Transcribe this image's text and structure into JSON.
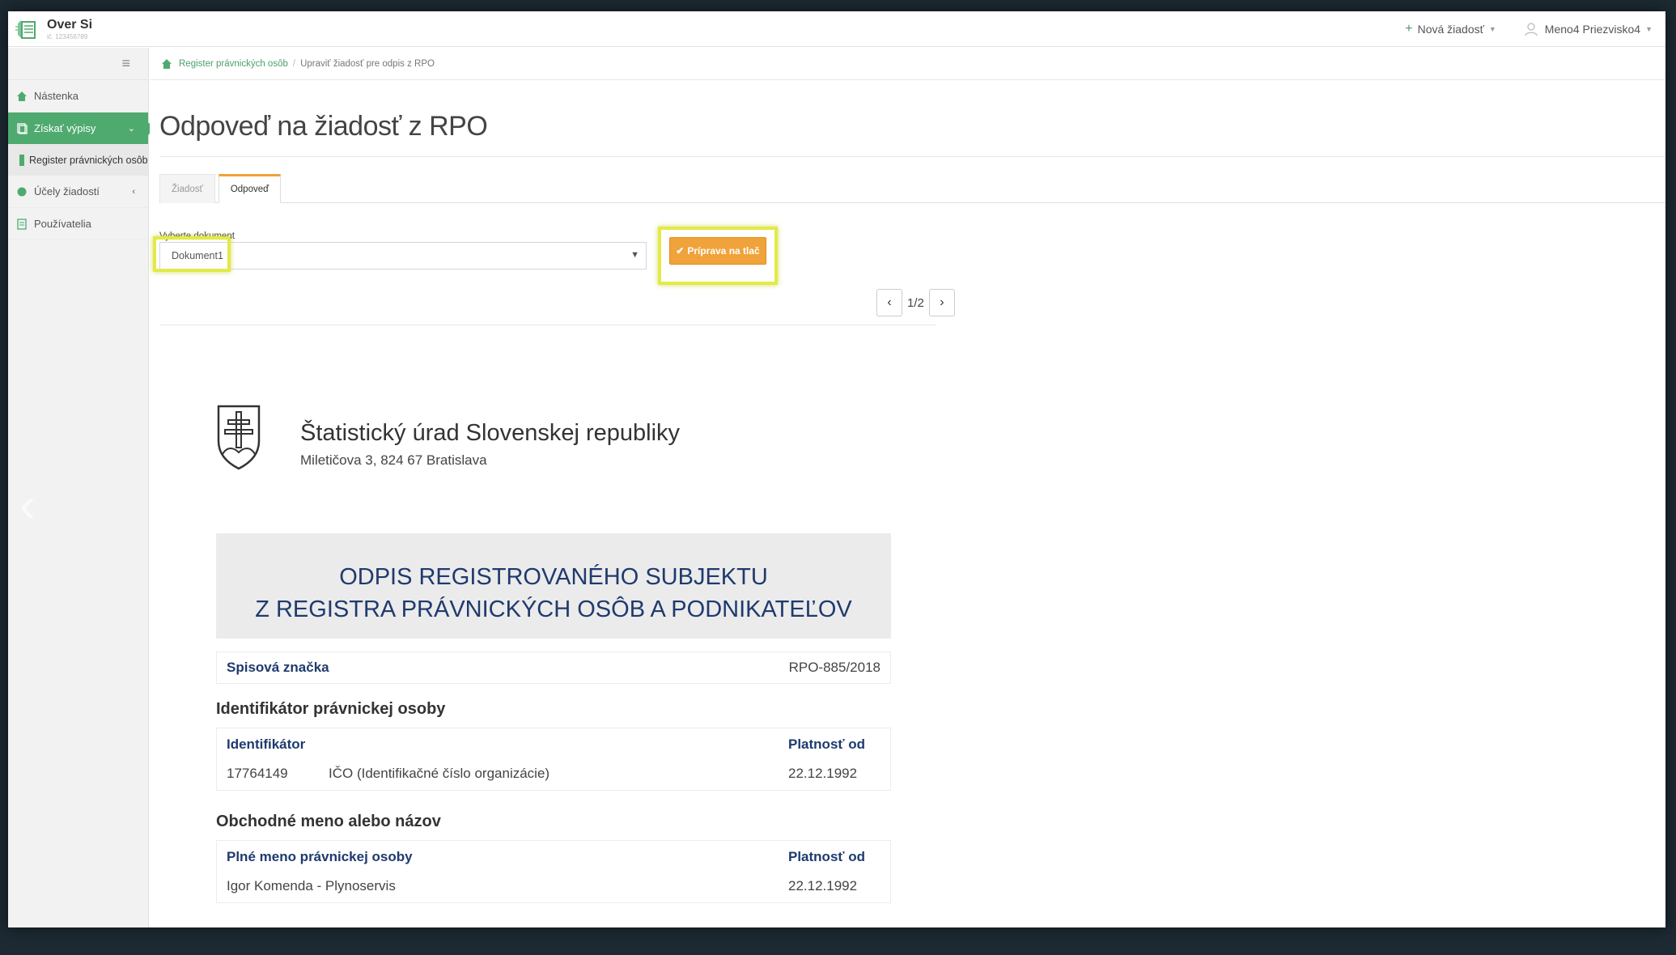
{
  "brand": {
    "name": "Over Si",
    "subtitle": "ič. 123456789"
  },
  "topbar": {
    "new_request": "Nová žiadosť",
    "user_name": "Meno4 Priezvisko4"
  },
  "sidebar": {
    "items": [
      {
        "label": "Nástenka"
      },
      {
        "label": "Získať výpisy"
      },
      {
        "label": "Register právnických osôb"
      },
      {
        "label": "Účely žiadostí"
      },
      {
        "label": "Používatelia"
      }
    ]
  },
  "breadcrumb": {
    "root": "Register právnických osôb",
    "current": "Upraviť žiadosť pre odpis z RPO"
  },
  "page": {
    "title": "Odpoveď na žiadosť z RPO"
  },
  "tabs": [
    {
      "label": "Žiadosť"
    },
    {
      "label": "Odpoveď"
    }
  ],
  "document_select": {
    "label": "Vyberte dokument",
    "value": "Dokument1"
  },
  "print_button": {
    "label": "Príprava na tlač"
  },
  "pager": {
    "text": "1/2"
  },
  "document": {
    "org_name": "Štatistický úrad Slovenskej republiky",
    "org_address": "Miletičova 3, 824 67 Bratislava",
    "banner_line1": "ODPIS REGISTROVANÉHO SUBJEKTU",
    "banner_line2": "Z REGISTRA PRÁVNICKÝCH OSÔB A PODNIKATEĽOV",
    "case_label": "Spisová značka",
    "case_value": "RPO-885/2018",
    "identifier_section": {
      "title": "Identifikátor právnickej osoby",
      "col1": "Identifikátor",
      "col2": "Platnosť od",
      "id_value": "17764149",
      "id_type": "IČO (Identifikačné číslo organizácie)",
      "valid_from": "22.12.1992"
    },
    "name_section": {
      "title": "Obchodné meno alebo názov",
      "col1": "Plné meno právnickej osoby",
      "col2": "Platnosť od",
      "name_value": "Igor Komenda - Plynoservis",
      "valid_from": "22.12.1992"
    }
  },
  "colors": {
    "accent_green": "#4faa6f",
    "button_orange": "#f0a33a",
    "highlight_yellow": "#e2ea48",
    "doc_heading_blue": "#1f3a6e"
  }
}
